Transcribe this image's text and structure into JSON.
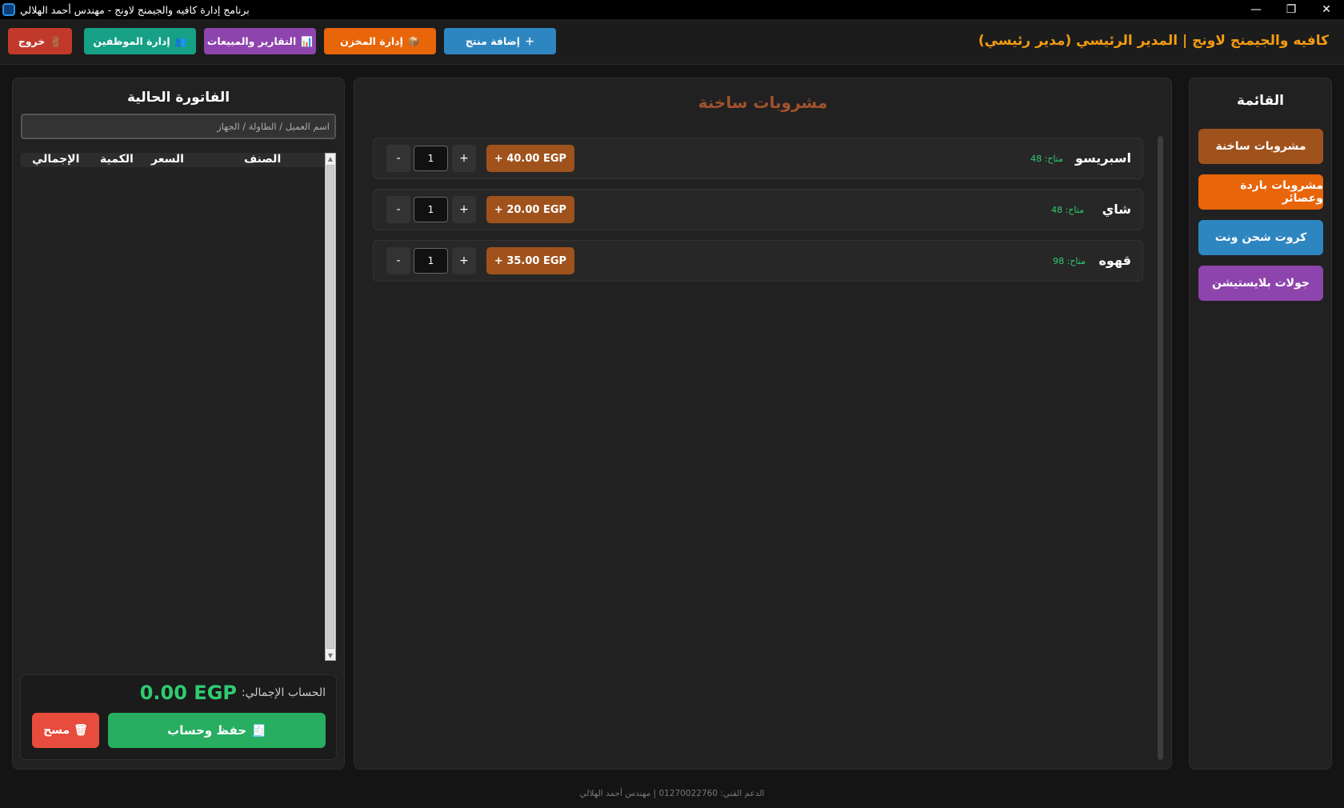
{
  "window": {
    "title": "برنامج إدارة كافيه والجيمنج لاونج - مهندس أحمد الهلالي",
    "minimize": "—",
    "restore": "❐",
    "close": "✕"
  },
  "header": {
    "title": "كافيه والجيمنج لاونج | المدير الرئيسي (مدير رئيسي)",
    "buttons": {
      "add_product": "إضافة منتج",
      "inventory": "إدارة المخزن",
      "reports": "التقارير والمبيعات",
      "employees": "إدارة الموظفين",
      "logout": "خروج"
    },
    "icons": {
      "add_product": "＋",
      "inventory": "📦",
      "reports": "📊",
      "employees": "👥",
      "logout": "🚪"
    }
  },
  "menu": {
    "title": "القائمة",
    "categories": [
      {
        "label": "مشروبات ساخنة",
        "color": "#a0521c"
      },
      {
        "label": "مشروبات باردة وعصائر",
        "color": "#e8650a"
      },
      {
        "label": "كروت شحن ونت",
        "color": "#2e86c1"
      },
      {
        "label": "جولات بلايستيشن",
        "color": "#8e44ad"
      }
    ]
  },
  "section": {
    "title": "مشروبات ساخنة",
    "products": [
      {
        "name": "اسبريسو",
        "stock": "متاح: 48",
        "price_label": "+ 40.00 EGP",
        "qty": "1"
      },
      {
        "name": "شاي",
        "stock": "متاح: 48",
        "price_label": "+ 20.00 EGP",
        "qty": "1"
      },
      {
        "name": "قهوه",
        "stock": "متاح: 98",
        "price_label": "+ 35.00 EGP",
        "qty": "1"
      }
    ],
    "minus": "-",
    "plus": "+"
  },
  "invoice": {
    "title": "الفاتورة الحالية",
    "customer_placeholder": "اسم العميل / الطاولة / الجهاز",
    "columns": {
      "item": "الصنف",
      "price": "السعر",
      "qty": "الكمية",
      "total": "الإجمالي"
    },
    "rows": [],
    "total_label": "الحساب الإجمالي:",
    "total_value": "0.00 EGP",
    "save_label": "حفظ وحساب",
    "clear_label": "مسح",
    "save_icon": "🧾",
    "clear_icon": "🗑"
  },
  "footer": {
    "text": "الدعم الفني: 01270022760 | مهندس أحمد الهلالي"
  },
  "colors": {
    "accent": "#f39c12",
    "success": "#2ecc71",
    "save": "#27ae60",
    "danger": "#e74c3c",
    "add_product": "#2e86c1",
    "inventory": "#e8650a",
    "reports": "#8e44ad",
    "employees": "#16a085",
    "logout": "#c0392b"
  }
}
